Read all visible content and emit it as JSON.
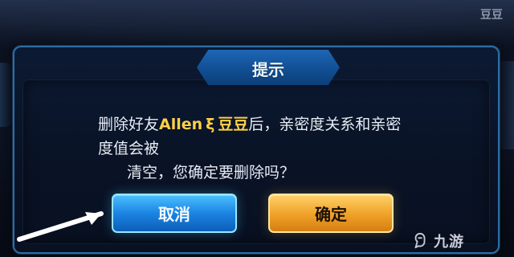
{
  "background": {
    "top_left_ghost_text": "",
    "top_right_ghost_text": "豆豆"
  },
  "dialog": {
    "title": "提示",
    "message": {
      "line1_prefix": "删除好友",
      "friend_name_part1": "Allen",
      "friend_separator": "ξ",
      "friend_name_part2": "豆豆",
      "line1_suffix": "后，亲密度关系和亲密度值会被",
      "line2": "清空，您确定要删除吗？"
    },
    "buttons": {
      "cancel_label": "取消",
      "ok_label": "确定"
    }
  },
  "watermark": {
    "text": "九游"
  },
  "colors": {
    "dialog_border": "#2c6da3",
    "title_bg": "#114f93",
    "name_highlight": "#ffd14a",
    "cancel_bg": "#1d86e4",
    "ok_bg": "#f0a329"
  },
  "icons": {
    "pointer_arrow": "arrow-right-icon",
    "watermark_logo": "jiuyou-logo-icon"
  }
}
